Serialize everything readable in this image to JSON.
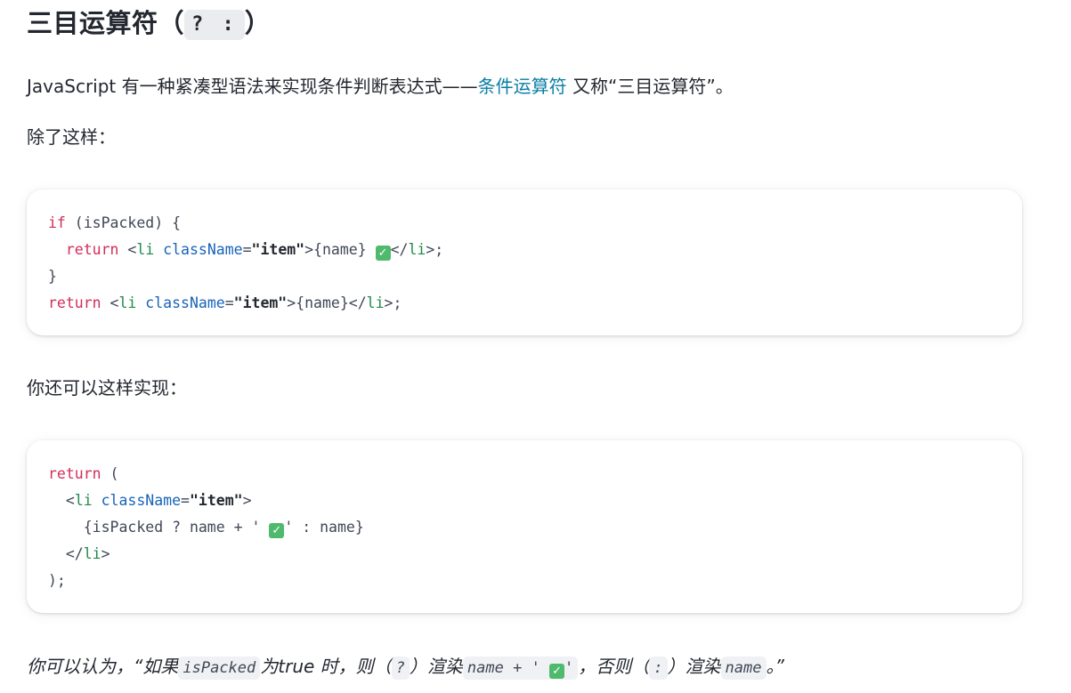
{
  "heading": {
    "text": "三目运算符（",
    "code": "? :",
    "close": "）"
  },
  "intro": {
    "before": "JavaScript 有一种紧凑型语法来实现条件判断表达式——",
    "link": "条件运算符",
    "after": " 又称“三目运算符”。"
  },
  "label_1": "除了这样：",
  "code_1": {
    "l1_kw": "if",
    "l1_rest": " (isPacked) {",
    "l2_kw": "return",
    "l2_lt": " <",
    "l2_tag": "li",
    "l2_attr": "className",
    "l2_eq": "=",
    "l2_str": "\"item\"",
    "l2_mid": ">{name} ",
    "l2_end": "</",
    "l2_tag2": "li",
    "l2_close": ">;",
    "l3": "}",
    "l4_kw": "return",
    "l4_lt": " <",
    "l4_tag": "li",
    "l4_attr": "className",
    "l4_eq": "=",
    "l4_str": "\"item\"",
    "l4_mid": ">{name}</",
    "l4_tag2": "li",
    "l4_close": ">;"
  },
  "label_2": "你还可以这样实现：",
  "code_2": {
    "l1_kw": "return",
    "l1_rest": " (",
    "l2_lt": "  <",
    "l2_tag": "li",
    "l2_attr": "className",
    "l2_eq": "=",
    "l2_str": "\"item\"",
    "l2_close": ">",
    "l3_a": "    {isPacked ? name + ' ",
    "l3_b": "' : name}",
    "l4_lt": "  </",
    "l4_tag": "li",
    "l4_close": ">",
    "l5": ");"
  },
  "summary": {
    "t1": "你可以认为，“如果",
    "c1": "isPacked",
    "t2": "为true 时，则（",
    "c2": "?",
    "t3": "）渲染",
    "c3a": "name + ' ",
    "c3b": "'",
    "t4": "，否则（",
    "c4": ":",
    "t5": "）渲染",
    "c5": "name",
    "t6": "。”"
  },
  "icons": {
    "check": "white-check-mark-icon",
    "check_glyph": "✓",
    "check_color": "#4fba6e"
  }
}
